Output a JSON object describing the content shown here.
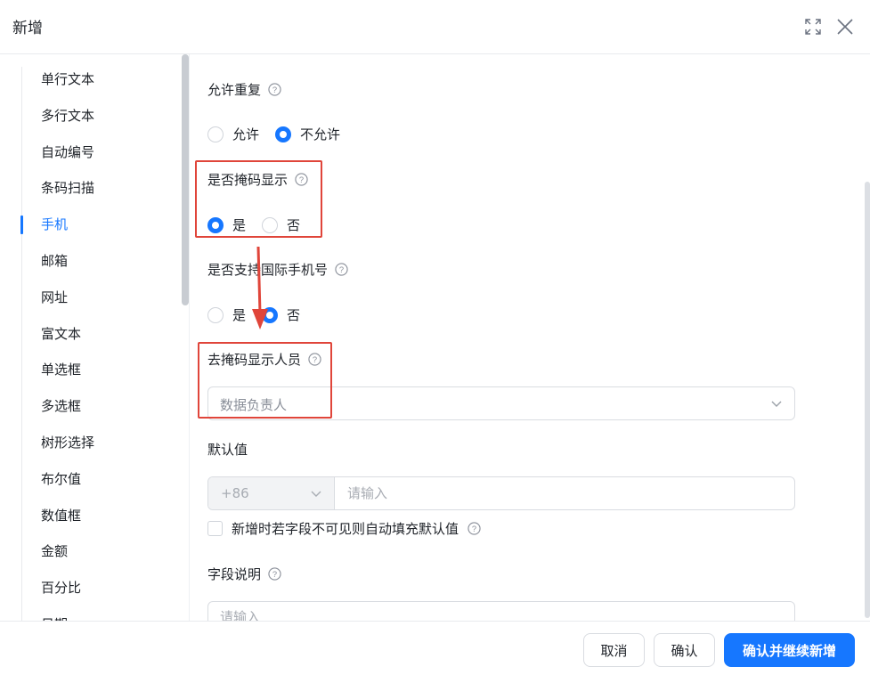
{
  "dialog": {
    "title": "新增",
    "fullscreen_icon": "fullscreen-icon",
    "close_icon": "close-icon"
  },
  "sidebar": {
    "items": [
      {
        "label": "单行文本",
        "active": false
      },
      {
        "label": "多行文本",
        "active": false
      },
      {
        "label": "自动编号",
        "active": false
      },
      {
        "label": "条码扫描",
        "active": false
      },
      {
        "label": "手机",
        "active": true
      },
      {
        "label": "邮箱",
        "active": false
      },
      {
        "label": "网址",
        "active": false
      },
      {
        "label": "富文本",
        "active": false
      },
      {
        "label": "单选框",
        "active": false
      },
      {
        "label": "多选框",
        "active": false
      },
      {
        "label": "树形选择",
        "active": false
      },
      {
        "label": "布尔值",
        "active": false
      },
      {
        "label": "数值框",
        "active": false
      },
      {
        "label": "金额",
        "active": false
      },
      {
        "label": "百分比",
        "active": false
      },
      {
        "label": "日期",
        "active": false
      }
    ]
  },
  "form": {
    "allow_duplicate": {
      "label": "允许重复",
      "options": [
        {
          "label": "允许",
          "checked": false
        },
        {
          "label": "不允许",
          "checked": true
        }
      ]
    },
    "mask_display": {
      "label": "是否掩码显示",
      "options": [
        {
          "label": "是",
          "checked": true
        },
        {
          "label": "否",
          "checked": false
        }
      ]
    },
    "international": {
      "label": "是否支持国际手机号",
      "options": [
        {
          "label": "是",
          "checked": false
        },
        {
          "label": "否",
          "checked": true
        }
      ]
    },
    "unmask_users": {
      "label": "去掩码显示人员",
      "value": "数据负责人"
    },
    "default_value": {
      "label": "默认值",
      "prefix": "+86",
      "placeholder": "请输入",
      "checkbox_label": "新增时若字段不可见则自动填充默认值"
    },
    "description": {
      "label": "字段说明",
      "placeholder": "请输入"
    }
  },
  "footer": {
    "cancel": "取消",
    "confirm": "确认",
    "confirm_continue": "确认并继续新增"
  },
  "colors": {
    "primary": "#1677ff",
    "annotation": "#e0453a"
  }
}
